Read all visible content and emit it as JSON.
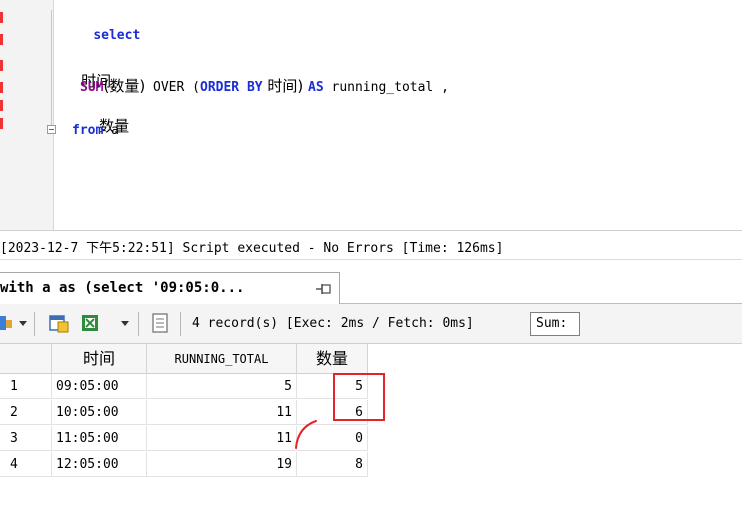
{
  "editor": {
    "lines": {
      "l1": "select",
      "l2": "时间,",
      "l3_fn": "SUM",
      "l3_arg": "(数量)",
      "l3_over": " OVER (",
      "l3_order": "ORDER BY",
      "l3_col": " 时间) ",
      "l3_as": "AS",
      "l3_alias": " running_total ,",
      "l4": "数量",
      "l5_kw": "from",
      "l5_tbl": " a"
    }
  },
  "message": {
    "text": "[2023-12-7 下午5:22:51] Script executed - No Errors [Time: 126ms]"
  },
  "result_tab": {
    "title": "with a as (select '09:05:0..."
  },
  "toolbar": {
    "status": "4 record(s) [Exec: 2ms / Fetch: 0ms]",
    "sum_label": "Sum:"
  },
  "grid": {
    "columns": [
      "时间",
      "RUNNING_TOTAL",
      "数量"
    ],
    "rows": [
      {
        "n": "1",
        "time": "09:05:00",
        "running_total": "5",
        "qty": "5"
      },
      {
        "n": "2",
        "time": "10:05:00",
        "running_total": "11",
        "qty": "6"
      },
      {
        "n": "3",
        "time": "11:05:00",
        "running_total": "11",
        "qty": "0"
      },
      {
        "n": "4",
        "time": "12:05:00",
        "running_total": "19",
        "qty": "8"
      }
    ]
  },
  "colors": {
    "keyword": "#1a2ed6",
    "function": "#8a0a8a",
    "annotation": "#e3242b"
  }
}
